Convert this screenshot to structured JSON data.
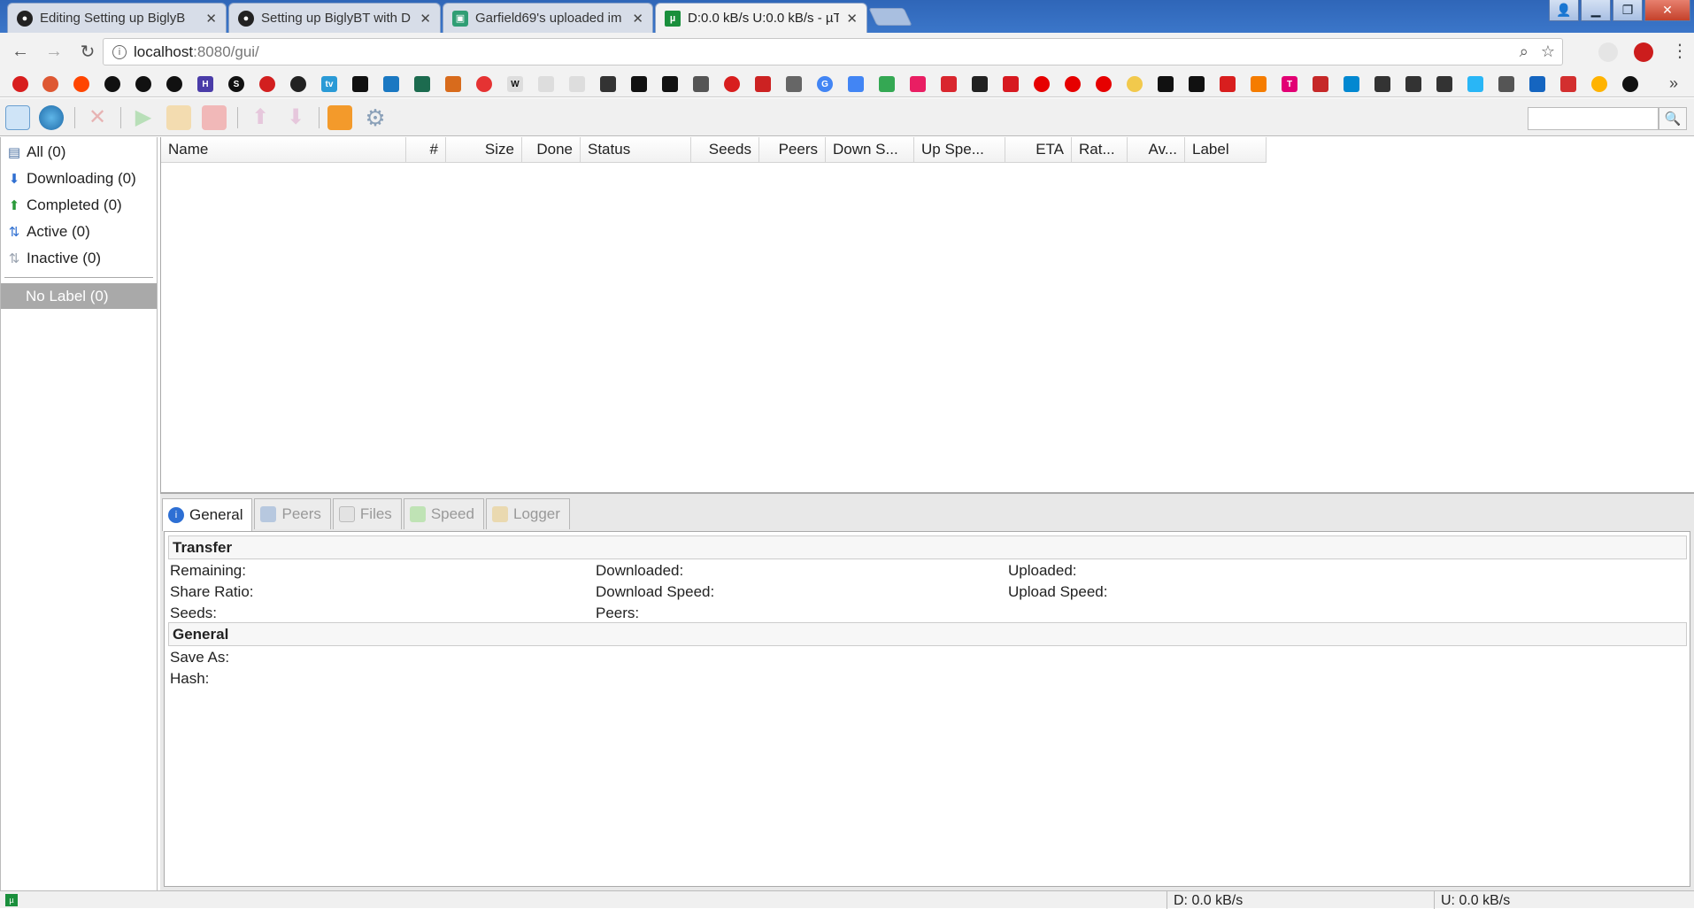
{
  "browser": {
    "tabs": [
      {
        "title": "Editing Setting up BiglyB",
        "favicon": "github-icon",
        "color": "#222222",
        "active": false
      },
      {
        "title": "Setting up BiglyBT with D",
        "favicon": "github-icon",
        "color": "#222222",
        "active": false
      },
      {
        "title": "Garfield69's uploaded im",
        "favicon": "image-host-icon",
        "color": "#2f9e74",
        "active": false
      },
      {
        "title": "D:0.0 kB/s U:0.0 kB/s - µT",
        "favicon": "utorrent-icon",
        "color": "#1a8f3c",
        "active": true
      }
    ],
    "url_host": "localhost",
    "url_path": ":8080/gui/"
  },
  "toolbar": {
    "search_placeholder": ""
  },
  "sidebar": {
    "categories": [
      {
        "label": "All (0)",
        "icon": "all-icon"
      },
      {
        "label": "Downloading (0)",
        "icon": "arrow-down-icon"
      },
      {
        "label": "Completed (0)",
        "icon": "arrow-up-icon"
      },
      {
        "label": "Active (0)",
        "icon": "active-arrows-icon"
      },
      {
        "label": "Inactive (0)",
        "icon": "inactive-arrows-icon"
      }
    ],
    "labels": [
      {
        "label": "No Label (0)"
      }
    ]
  },
  "torrent_list": {
    "columns": [
      "Name",
      "#",
      "Size",
      "Done",
      "Status",
      "Seeds",
      "Peers",
      "Down S...",
      "Up Spe...",
      "ETA",
      "Rat...",
      "Av...",
      "Label"
    ],
    "rows": []
  },
  "detail_tabs": [
    {
      "label": "General",
      "icon": "info-icon",
      "active": true
    },
    {
      "label": "Peers",
      "icon": "peers-icon",
      "active": false
    },
    {
      "label": "Files",
      "icon": "files-icon",
      "active": false
    },
    {
      "label": "Speed",
      "icon": "speed-graph-icon",
      "active": false
    },
    {
      "label": "Logger",
      "icon": "logger-icon",
      "active": false
    }
  ],
  "general": {
    "transfer_title": "Transfer",
    "remaining": "Remaining:",
    "share_ratio": "Share Ratio:",
    "seeds": "Seeds:",
    "downloaded": "Downloaded:",
    "download_speed": "Download Speed:",
    "peers": "Peers:",
    "uploaded": "Uploaded:",
    "upload_speed": "Upload Speed:",
    "general_title": "General",
    "save_as": "Save As:",
    "hash": "Hash:"
  },
  "status": {
    "download": "D: 0.0 kB/s",
    "upload": "U: 0.0 kB/s"
  }
}
